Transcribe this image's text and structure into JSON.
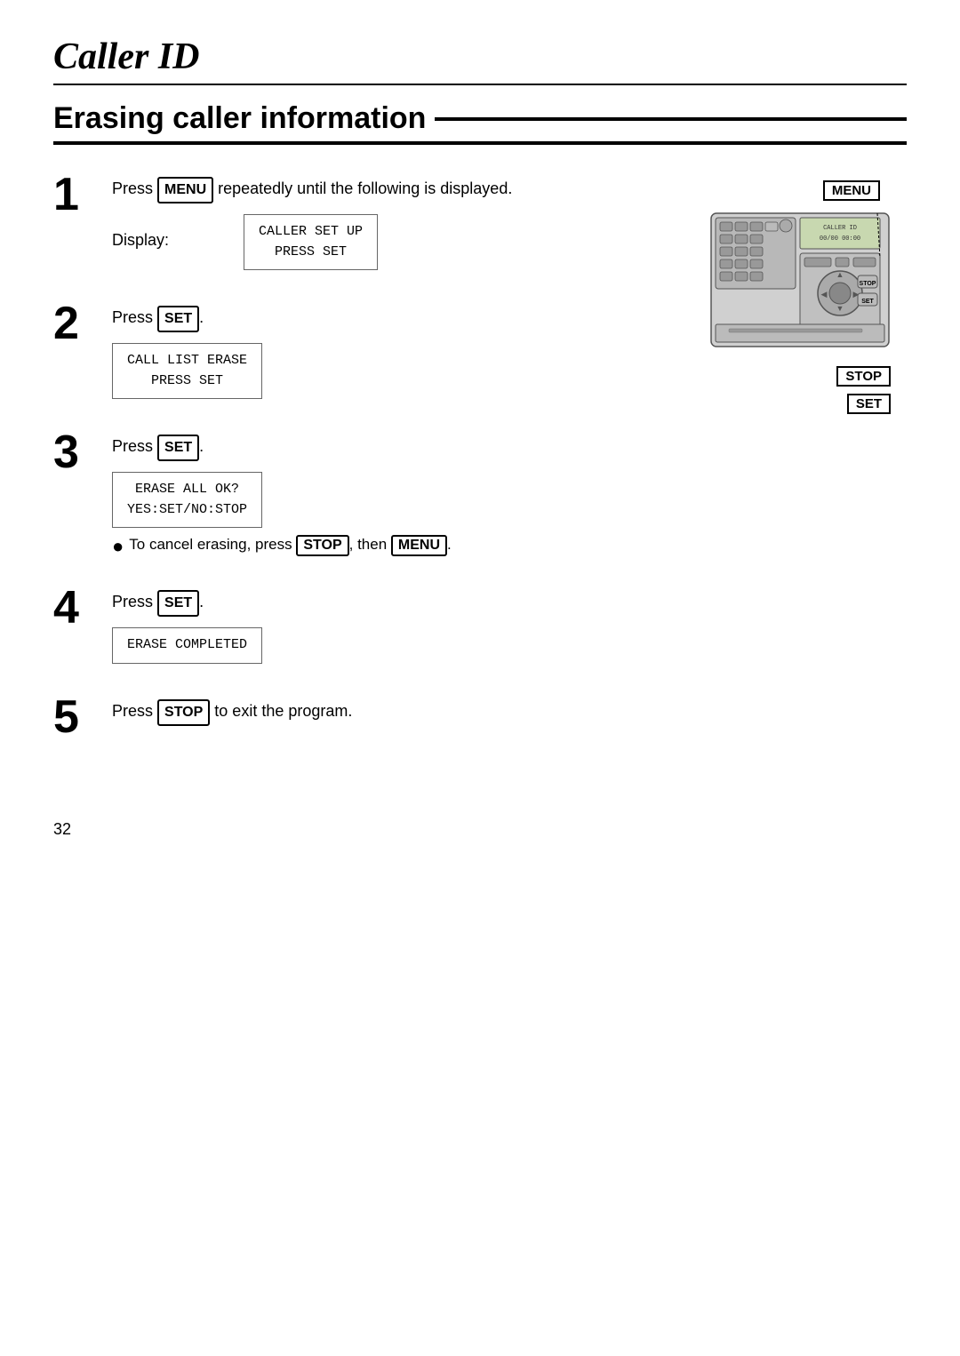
{
  "page": {
    "title": "Caller ID",
    "section": "Erasing caller information",
    "page_number": "32"
  },
  "steps": [
    {
      "number": "1",
      "text_before": "Press ",
      "key1": "MENU",
      "text_after": " repeatedly until the following is displayed.",
      "display_label": "Display:",
      "display_lines": [
        "CALLER SET UP",
        "PRESS SET"
      ]
    },
    {
      "number": "2",
      "text_before": "Press ",
      "key1": "SET",
      "text_after": ".",
      "display_lines": [
        "CALL LIST ERASE",
        "PRESS SET"
      ]
    },
    {
      "number": "3",
      "text_before": "Press ",
      "key1": "SET",
      "text_after": ".",
      "display_lines": [
        "ERASE ALL OK?",
        "YES:SET/NO:STOP"
      ],
      "bullet": {
        "text_before": "To cancel erasing, press ",
        "key1": "STOP",
        "text_middle": ", then ",
        "key2": "MENU",
        "text_after": "."
      }
    },
    {
      "number": "4",
      "text_before": "Press ",
      "key1": "SET",
      "text_after": ".",
      "display_lines": [
        "ERASE COMPLETED"
      ]
    },
    {
      "number": "5",
      "text_before": "Press ",
      "key1": "STOP",
      "text_after": " to exit the program."
    }
  ],
  "device": {
    "menu_label": "MENU",
    "stop_label": "STOP",
    "set_label": "SET"
  }
}
